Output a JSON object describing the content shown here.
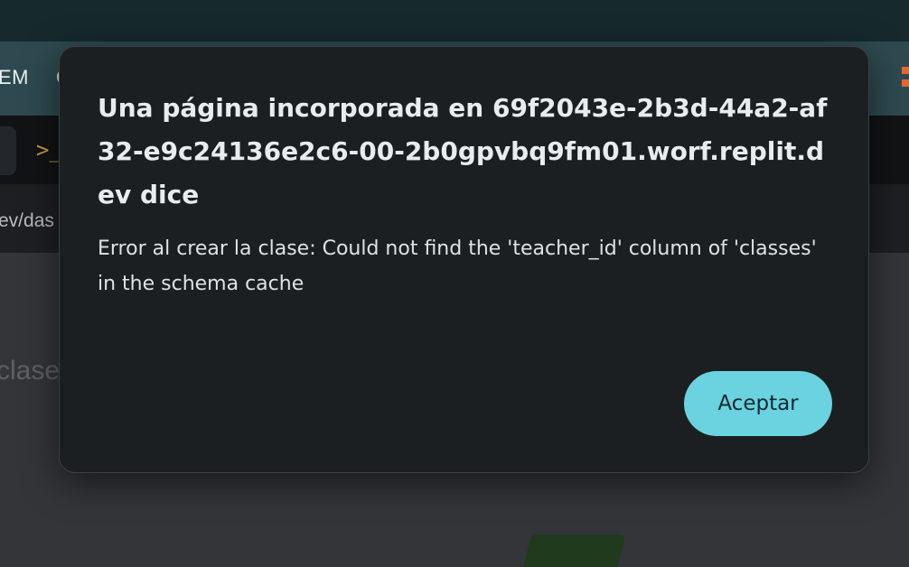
{
  "background": {
    "nav_text": "EM",
    "nav_partial": "C",
    "prompt_symbol": ">_",
    "url_fragment": "ev/das",
    "page_heading_fragment": "clase"
  },
  "dialog": {
    "title": "Una página incorporada en 69f2043e-2b3d-44a2-af32-e9c24136e2c6-00-2b0gpvbq9fm01.worf.replit.dev dice",
    "message": "Error al crear la clase: Could not find the 'teacher_id' column of 'classes' in the schema cache",
    "accept_label": "Aceptar"
  },
  "colors": {
    "dialog_bg": "#1b1f21",
    "button_accent": "#6bd2df",
    "brand": "#e8672b"
  }
}
